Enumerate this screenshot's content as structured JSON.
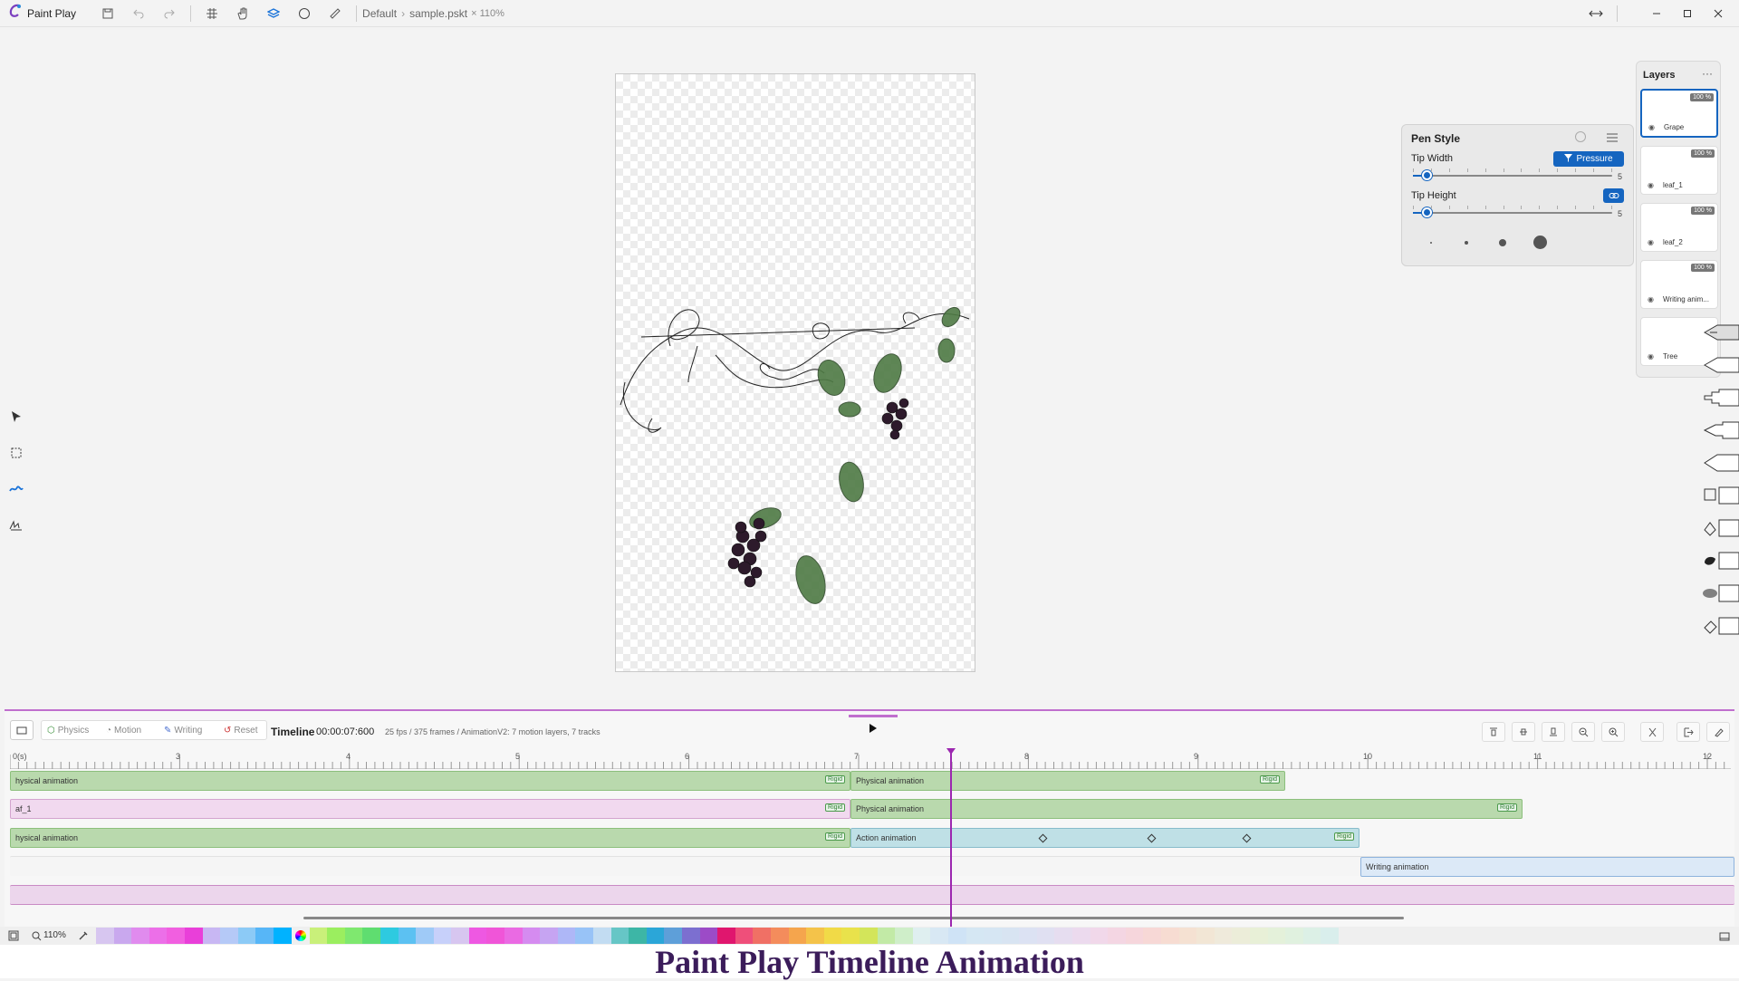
{
  "app": {
    "name": "Paint Play"
  },
  "breadcrumb": {
    "root": "Default",
    "file": "sample.pskt",
    "zoom": "× 110%"
  },
  "pen_style": {
    "title": "Pen Style",
    "tip_width_label": "Tip Width",
    "tip_width_value": "5",
    "tip_height_label": "Tip Height",
    "tip_height_value": "5",
    "pressure_label": "Pressure"
  },
  "layers_panel": {
    "title": "Layers",
    "more": "···",
    "items": [
      {
        "name": "Grape",
        "opacity": "100 %"
      },
      {
        "name": "leaf_1",
        "opacity": "100 %"
      },
      {
        "name": "leaf_2",
        "opacity": "100 %"
      },
      {
        "name": "Writing anim...",
        "opacity": "100 %"
      },
      {
        "name": "Tree",
        "opacity": ""
      }
    ]
  },
  "timeline": {
    "physics": "Physics",
    "motion": "Motion",
    "writing": "Writing",
    "reset": "Reset",
    "title": "Timeline",
    "time": "00:00:07:600",
    "info": "25 fps / 375 frames / AnimationV2: 7 motion layers, 7 tracks",
    "ruler_start": "0(s)",
    "ruler_labels": [
      "3",
      "4",
      "5",
      "6",
      "7",
      "8",
      "9",
      "10",
      "11",
      "12"
    ],
    "tracks": [
      {
        "label": "hysical animation",
        "tag": "Rigid"
      },
      {
        "label": "Physical animation",
        "tag": "Rigid"
      },
      {
        "label": "af_1",
        "tag": "Rigid"
      },
      {
        "label": "Physical animation",
        "tag": "Rigid"
      },
      {
        "label": "hysical animation",
        "tag": "Rigid"
      },
      {
        "label": "Action animation",
        "tag": "Rigid"
      },
      {
        "label": "Writing animation",
        "tag": ""
      }
    ]
  },
  "status": {
    "zoom": "110%"
  },
  "palette": [
    "#d7c6f0",
    "#c9a8ee",
    "#e08bee",
    "#ec6fe8",
    "#f15fe0",
    "#e93fd9",
    "#c8b7f3",
    "#b5c9f7",
    "#8ccaf6",
    "#57b6f7",
    "#00b2ff",
    "#ffffff",
    "#c9f07a",
    "#9bee5f",
    "#7fe86f",
    "#5fdd70",
    "#2ecae0",
    "#5cc1f2",
    "#9fcaf7",
    "#c7d0fa",
    "#d7c6f0",
    "#ee58e2",
    "#f055d8",
    "#ea6ae3",
    "#d58bf0",
    "#c6a4f2",
    "#aeb7f7",
    "#98c3f7",
    "#c2dcf2",
    "#66c6c6",
    "#3db6a6",
    "#2ba6d8",
    "#5e9fd9",
    "#7c6fd0",
    "#9c4bc7",
    "#e0166e",
    "#ef4f7a",
    "#f07065",
    "#f48c5c",
    "#f5a54d",
    "#f4c34a",
    "#f1da47",
    "#e9e24b",
    "#d3e55a",
    "#c2eaa6",
    "#cfeec9",
    "#dfeff0",
    "#d8e8f4",
    "#cfe3f6",
    "#d5e7f3",
    "#d6e6f3",
    "#d8e4f2",
    "#dce2f3",
    "#e0e0f2",
    "#e6ddf0",
    "#ecdaee",
    "#f1d8ea",
    "#f4d6e3",
    "#f6d6dc",
    "#f7d8d6",
    "#f7dcd2",
    "#f5e1d2",
    "#f2e6d5",
    "#efeadb",
    "#ecedd9",
    "#e8f0d7",
    "#e4f1da",
    "#e0f1df",
    "#dcf0e6",
    "#d9eeec"
  ],
  "caption": "Paint Play Timeline Animation"
}
